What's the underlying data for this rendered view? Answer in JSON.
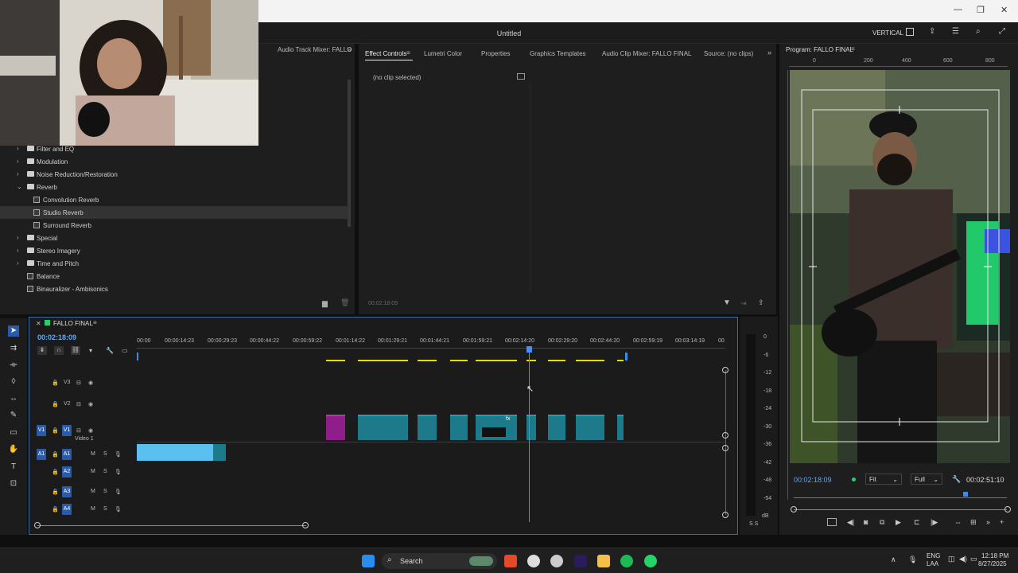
{
  "window": {
    "title": "Untitled",
    "workspace": "VERTICAL"
  },
  "effects_panel": {
    "tab": "Audio Track Mixer: FALLO",
    "items": [
      {
        "label": "Filter and EQ",
        "type": "folder",
        "expanded": false
      },
      {
        "label": "Modulation",
        "type": "folder",
        "expanded": false
      },
      {
        "label": "Noise Reduction/Restoration",
        "type": "folder",
        "expanded": false
      },
      {
        "label": "Reverb",
        "type": "folder",
        "expanded": true
      },
      {
        "label": "Convolution Reverb",
        "type": "effect"
      },
      {
        "label": "Studio Reverb",
        "type": "effect"
      },
      {
        "label": "Surround Reverb",
        "type": "effect"
      },
      {
        "label": "Special",
        "type": "folder",
        "expanded": false
      },
      {
        "label": "Stereo Imagery",
        "type": "folder",
        "expanded": false
      },
      {
        "label": "Time and Pitch",
        "type": "folder",
        "expanded": false
      },
      {
        "label": "Balance",
        "type": "effect"
      },
      {
        "label": "Binauralizer - Ambisonics",
        "type": "effect"
      }
    ]
  },
  "center_tabs": [
    "Effect Controls",
    "Lumetri Color",
    "Properties",
    "Graphics Templates",
    "Audio Clip Mixer: FALLO FINAL",
    "Source: (no clips)"
  ],
  "effect_controls": {
    "empty": "(no clip selected)",
    "timecode": "00:02:18:09"
  },
  "program": {
    "title": "Program: FALLO FINAL",
    "ruler": [
      "0",
      "200",
      "400",
      "600",
      "800"
    ],
    "timecode": "00:02:18:09",
    "fit": "Fit",
    "quality": "Full",
    "duration": "00:02:51:10"
  },
  "timeline": {
    "sequence": "FALLO FINAL",
    "timecode": "00:02:18:09",
    "ruler": [
      "00:00",
      "00:00:14:23",
      "00:00:29:23",
      "00:00:44:22",
      "00:00:59:22",
      "00:01:14:22",
      "00:01:29:21",
      "00:01:44:21",
      "00:01:59:21",
      "00:02:14:20",
      "00:02:29:20",
      "00:02:44:20",
      "00:02:59:19",
      "00:03:14:19",
      "00"
    ],
    "tracks": [
      {
        "id": "V3",
        "name": ""
      },
      {
        "id": "V2",
        "name": ""
      },
      {
        "id": "V1",
        "name": "Video 1"
      },
      {
        "id": "A1",
        "name": ""
      },
      {
        "id": "A2",
        "name": ""
      },
      {
        "id": "A3",
        "name": ""
      },
      {
        "id": "A4",
        "name": ""
      }
    ]
  },
  "meter": {
    "labels": [
      "0",
      "-6",
      "-12",
      "-18",
      "-24",
      "-30",
      "-36",
      "-42",
      "-48",
      "-54",
      "dB"
    ],
    "solo": "S S"
  },
  "taskbar": {
    "search": "Search",
    "lang": "ENG",
    "lang2": "LAA",
    "time": "12:18 PM",
    "date": "8/27/2025"
  }
}
